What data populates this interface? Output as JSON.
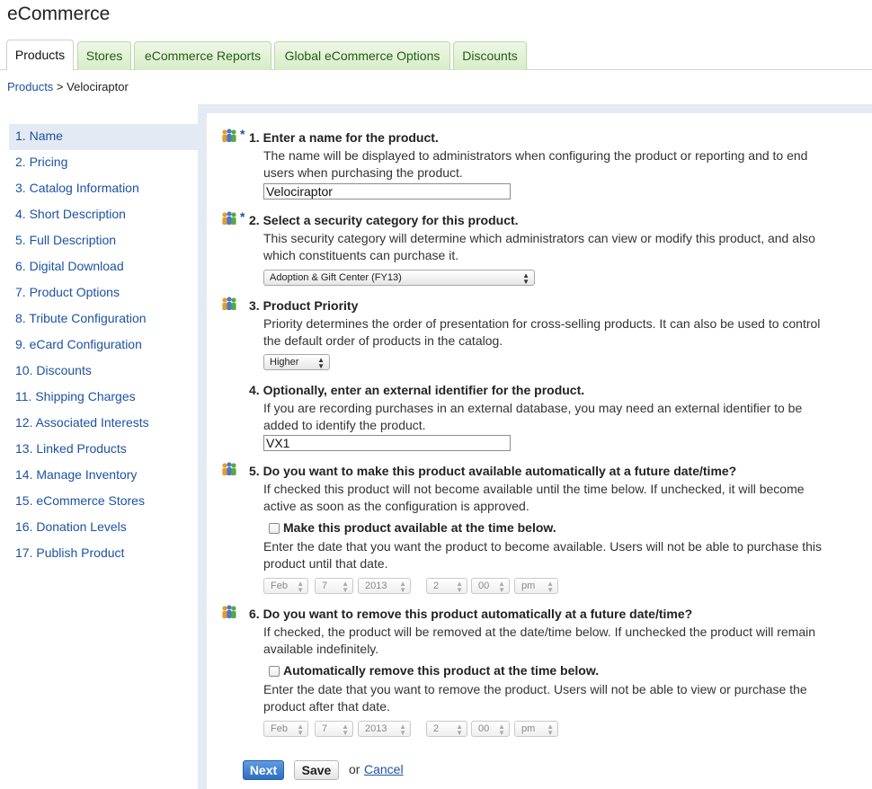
{
  "app": {
    "title": "eCommerce"
  },
  "tabs": [
    {
      "label": "Products",
      "active": true
    },
    {
      "label": "Stores"
    },
    {
      "label": "eCommerce Reports"
    },
    {
      "label": "Global eCommerce Options"
    },
    {
      "label": "Discounts"
    }
  ],
  "breadcrumb": {
    "link": "Products",
    "separator": " > ",
    "current": "Velociraptor"
  },
  "sidebar": {
    "items": [
      {
        "num": "1.",
        "label": "Name",
        "active": true
      },
      {
        "num": "2.",
        "label": "Pricing"
      },
      {
        "num": "3.",
        "label": "Catalog Information"
      },
      {
        "num": "4.",
        "label": "Short Description"
      },
      {
        "num": "5.",
        "label": "Full Description"
      },
      {
        "num": "6.",
        "label": "Digital Download"
      },
      {
        "num": "7.",
        "label": "Product Options"
      },
      {
        "num": "8.",
        "label": "Tribute Configuration"
      },
      {
        "num": "9.",
        "label": "eCard Configuration"
      },
      {
        "num": "10.",
        "label": "Discounts"
      },
      {
        "num": "11.",
        "label": "Shipping Charges"
      },
      {
        "num": "12.",
        "label": "Associated Interests"
      },
      {
        "num": "13.",
        "label": "Linked Products"
      },
      {
        "num": "14.",
        "label": "Manage Inventory"
      },
      {
        "num": "15.",
        "label": "eCommerce Stores"
      },
      {
        "num": "16.",
        "label": "Donation Levels"
      },
      {
        "num": "17.",
        "label": "Publish Product"
      }
    ]
  },
  "sections": {
    "s1": {
      "title": "1. Enter a name for the product.",
      "required": "*",
      "desc": "The name will be displayed to administrators when configuring the product or reporting and to end users when purchasing the product.",
      "value": "Velociraptor"
    },
    "s2": {
      "title": "2. Select a security category for this product.",
      "required": "*",
      "desc": "This security category will determine which administrators can view or modify this product, and also which constituents can purchase it.",
      "selected": "Adoption & Gift Center (FY13)"
    },
    "s3": {
      "title": "3. Product Priority",
      "desc": "Priority determines the order of presentation for cross-selling products. It can also be used to control the default order of products in the catalog.",
      "selected": "Higher"
    },
    "s4": {
      "title": "4. Optionally, enter an external identifier for the product.",
      "desc": "If you are recording purchases in an external database, you may need an external identifier to be added to identify the product.",
      "value": "VX1"
    },
    "s5": {
      "title": "5. Do you want to make this product available automatically at a future date/time?",
      "desc": "If checked this product will not become available until the time below. If unchecked, it will become active as soon as the configuration is approved.",
      "checkbox_label": "Make this product available at the time below.",
      "checked": false,
      "date_desc": "Enter the date that you want the product to become available. Users will not be able to purchase this product until that date.",
      "month": "Feb",
      "day": "7",
      "year": "2013",
      "hour": "2",
      "minute": "00",
      "ampm": "pm"
    },
    "s6": {
      "title": "6. Do you want to remove this product automatically at a future date/time?",
      "desc": "If checked, the product will be removed at the date/time below. If unchecked the product will remain available indefinitely.",
      "checkbox_label": "Automatically remove this product at the time below.",
      "checked": false,
      "date_desc": "Enter the date that you want to remove the product. Users will not be able to view or purchase the product after that date.",
      "month": "Feb",
      "day": "7",
      "year": "2013",
      "hour": "2",
      "minute": "00",
      "ampm": "pm"
    }
  },
  "actions": {
    "next": "Next",
    "save": "Save",
    "or": "or",
    "cancel": "Cancel"
  },
  "colors": {
    "link": "#1d52a3",
    "tab_green": "#1f5e13",
    "band": "#e3eaf3",
    "primary_button": "#2e6fc4"
  }
}
